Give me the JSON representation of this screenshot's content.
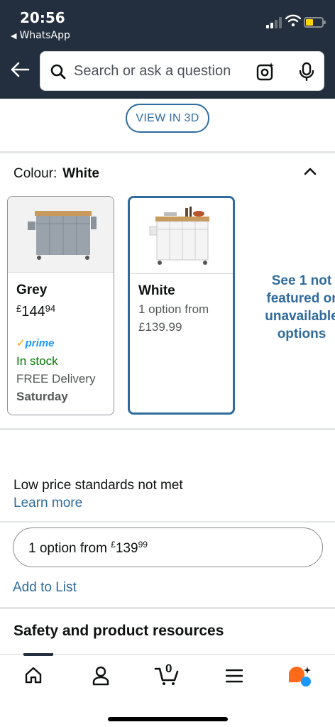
{
  "status_bar": {
    "time": "20:56",
    "back_app": "WhatsApp"
  },
  "search": {
    "placeholder": "Search or ask a question"
  },
  "view_3d": {
    "label": "VIEW IN 3D"
  },
  "colour": {
    "label": "Colour:",
    "selected": "White"
  },
  "variants": [
    {
      "name": "Grey",
      "price_currency": "£",
      "price_whole": "144",
      "price_fraction": "94",
      "prime": "prime",
      "stock": "In stock",
      "delivery": "FREE Delivery",
      "delivery_day": "Saturday"
    },
    {
      "name": "White",
      "options_line1": "1 option from",
      "options_line2": "£139.99"
    }
  ],
  "see_more": {
    "line1": "See 1 not",
    "line2": "featured or",
    "line3": "unavailable",
    "line4": "options"
  },
  "low_price": {
    "text": "Low price standards not met",
    "link": "Learn more"
  },
  "option_pill": {
    "prefix": "1 option from ",
    "currency": "£",
    "whole": "139",
    "fraction": "99"
  },
  "add_to_list": "Add to List",
  "safety": "Safety and product resources",
  "bottom_nav": {
    "cart_count": "0"
  },
  "colors": {
    "header_bg": "#232f3e",
    "link": "#2f6b9d",
    "in_stock": "#007600",
    "prime": "#1a98ff",
    "rufus": "#ff6a1a"
  }
}
